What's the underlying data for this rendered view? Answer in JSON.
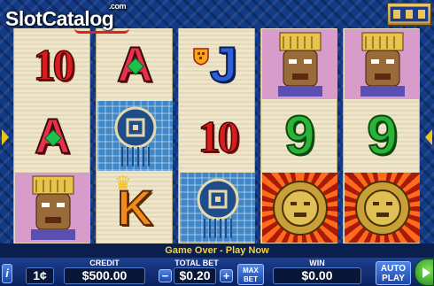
{
  "logo": {
    "part1": "Slot",
    "part2": "Catalog",
    "suffix": ".com"
  },
  "reels": [
    [
      {
        "kind": "ten",
        "label": "10"
      },
      {
        "kind": "ace",
        "label": "A"
      },
      {
        "kind": "mask",
        "label": ""
      }
    ],
    [
      {
        "kind": "ace",
        "label": "A"
      },
      {
        "kind": "shield",
        "label": ""
      },
      {
        "kind": "king",
        "label": "K"
      }
    ],
    [
      {
        "kind": "jack",
        "label": "J"
      },
      {
        "kind": "ten",
        "label": "10"
      },
      {
        "kind": "shield",
        "label": ""
      }
    ],
    [
      {
        "kind": "mask",
        "label": ""
      },
      {
        "kind": "nine",
        "label": "9"
      },
      {
        "kind": "sun",
        "label": ""
      }
    ],
    [
      {
        "kind": "mask",
        "label": ""
      },
      {
        "kind": "nine",
        "label": "9"
      },
      {
        "kind": "sun",
        "label": ""
      }
    ]
  ],
  "message": "Game Over - Play Now",
  "controls": {
    "credit_label": "CREDIT",
    "credit_value": "$500.00",
    "denom_value": "1¢",
    "total_bet_label": "TOTAL BET",
    "total_bet_value": "$0.20",
    "minus_label": "−",
    "plus_label": "+",
    "max_bet_line1": "MAX",
    "max_bet_line2": "BET",
    "win_label": "WIN",
    "win_value": "$0.00",
    "auto_play_line1": "AUTO",
    "auto_play_line2": "PLAY",
    "info_label": "i"
  },
  "colors": {
    "message": "#f4d33a",
    "panel": "#0b2260"
  }
}
